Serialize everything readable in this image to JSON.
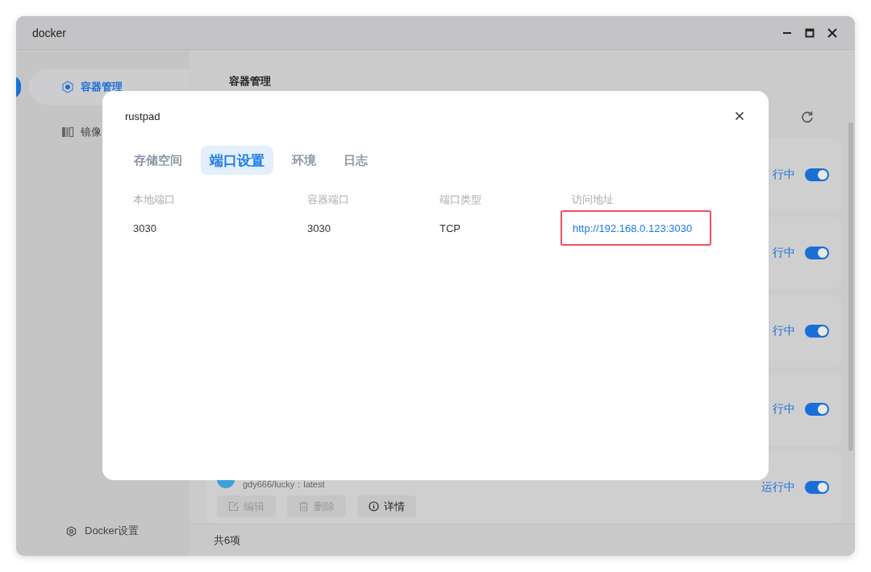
{
  "window": {
    "title": "docker"
  },
  "sidebar": {
    "items": [
      {
        "label": "容器管理",
        "selected": true
      },
      {
        "label": "镜像",
        "selected": false
      }
    ],
    "footer_item": "Docker设置"
  },
  "main": {
    "title": "容器管理",
    "containers": [
      {
        "status": "行中",
        "on": true
      },
      {
        "status": "行中",
        "on": true
      },
      {
        "status": "行中",
        "on": true
      },
      {
        "status": "行中",
        "on": true
      },
      {
        "image": "gdy666/lucky：latest",
        "status": "运行中",
        "on": true,
        "actions": [
          {
            "label": "编辑",
            "disabled": true
          },
          {
            "label": "删除",
            "disabled": true
          },
          {
            "label": "详情",
            "disabled": false
          }
        ]
      }
    ],
    "footer": "共6项"
  },
  "dialog": {
    "title": "rustpad",
    "tabs": [
      {
        "label": "存储空间",
        "selected": false
      },
      {
        "label": "端口设置",
        "selected": true
      },
      {
        "label": "环境",
        "selected": false
      },
      {
        "label": "日志",
        "selected": false
      }
    ],
    "table": {
      "columns": [
        "本地端口",
        "容器端口",
        "端口类型",
        "访问地址"
      ],
      "rows": [
        {
          "cells": [
            "3030",
            "3030",
            "TCP"
          ],
          "address": "http://192.168.0.123:3030",
          "highlighted": true
        }
      ]
    }
  }
}
